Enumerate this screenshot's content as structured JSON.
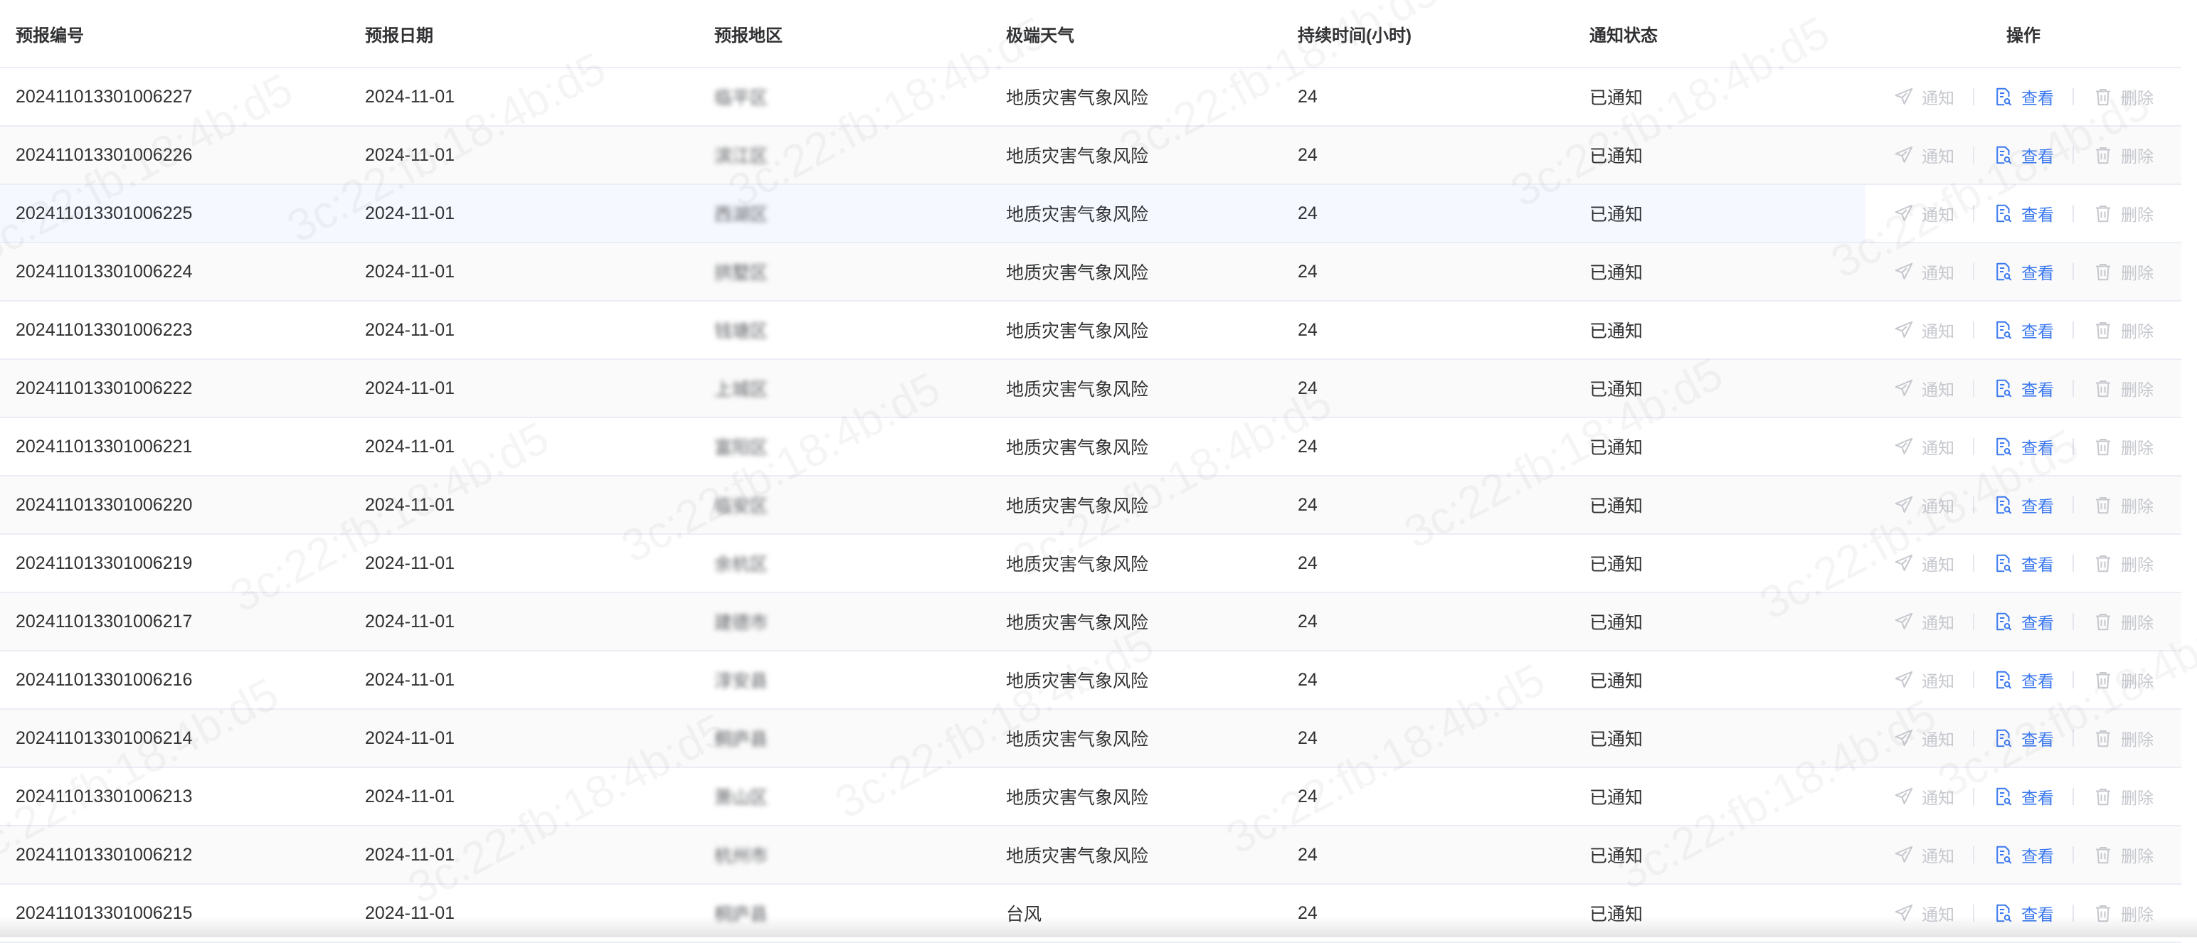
{
  "table": {
    "headers": {
      "id": "预报编号",
      "date": "预报日期",
      "region": "预报地区",
      "weather": "极端天气",
      "duration": "持续时间(小时)",
      "status": "通知状态",
      "ops": "操作"
    },
    "actions": {
      "notify": "通知",
      "view": "查看",
      "delete": "删除"
    },
    "rows": [
      {
        "id": "202411013301006227",
        "date": "2024-11-01",
        "region": "临平区",
        "weather": "地质灾害气象风险",
        "duration": "24",
        "status": "已通知"
      },
      {
        "id": "202411013301006226",
        "date": "2024-11-01",
        "region": "滨江区",
        "weather": "地质灾害气象风险",
        "duration": "24",
        "status": "已通知"
      },
      {
        "id": "202411013301006225",
        "date": "2024-11-01",
        "region": "西湖区",
        "weather": "地质灾害气象风险",
        "duration": "24",
        "status": "已通知"
      },
      {
        "id": "202411013301006224",
        "date": "2024-11-01",
        "region": "拱墅区",
        "weather": "地质灾害气象风险",
        "duration": "24",
        "status": "已通知"
      },
      {
        "id": "202411013301006223",
        "date": "2024-11-01",
        "region": "钱塘区",
        "weather": "地质灾害气象风险",
        "duration": "24",
        "status": "已通知"
      },
      {
        "id": "202411013301006222",
        "date": "2024-11-01",
        "region": "上城区",
        "weather": "地质灾害气象风险",
        "duration": "24",
        "status": "已通知"
      },
      {
        "id": "202411013301006221",
        "date": "2024-11-01",
        "region": "富阳区",
        "weather": "地质灾害气象风险",
        "duration": "24",
        "status": "已通知"
      },
      {
        "id": "202411013301006220",
        "date": "2024-11-01",
        "region": "临安区",
        "weather": "地质灾害气象风险",
        "duration": "24",
        "status": "已通知"
      },
      {
        "id": "202411013301006219",
        "date": "2024-11-01",
        "region": "余杭区",
        "weather": "地质灾害气象风险",
        "duration": "24",
        "status": "已通知"
      },
      {
        "id": "202411013301006217",
        "date": "2024-11-01",
        "region": "建德市",
        "weather": "地质灾害气象风险",
        "duration": "24",
        "status": "已通知"
      },
      {
        "id": "202411013301006216",
        "date": "2024-11-01",
        "region": "淳安县",
        "weather": "地质灾害气象风险",
        "duration": "24",
        "status": "已通知"
      },
      {
        "id": "202411013301006214",
        "date": "2024-11-01",
        "region": "桐庐县",
        "weather": "地质灾害气象风险",
        "duration": "24",
        "status": "已通知"
      },
      {
        "id": "202411013301006213",
        "date": "2024-11-01",
        "region": "萧山区",
        "weather": "地质灾害气象风险",
        "duration": "24",
        "status": "已通知"
      },
      {
        "id": "202411013301006212",
        "date": "2024-11-01",
        "region": "杭州市",
        "weather": "地质灾害气象风险",
        "duration": "24",
        "status": "已通知"
      },
      {
        "id": "202411013301006215",
        "date": "2024-11-01",
        "region": "桐庐县",
        "weather": "台风",
        "duration": "24",
        "status": "已通知"
      }
    ]
  },
  "watermark": {
    "text": "3c:22:fb:18:4b:d5"
  },
  "colors": {
    "accent": "#3a78f0",
    "disabled": "#c6c8ce",
    "text": "#303133",
    "border": "#ebeef5"
  },
  "icons": {
    "notify": "send-icon",
    "view": "file-search-icon",
    "delete": "trash-icon"
  }
}
